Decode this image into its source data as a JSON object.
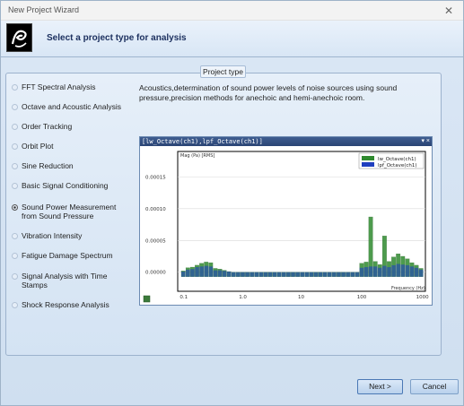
{
  "window": {
    "title": "New Project Wizard",
    "close_glyph": "✕"
  },
  "header": {
    "title": "Select a project type for analysis",
    "logo_icon": "app-logo-icon"
  },
  "group_label": "Project type",
  "project_types": [
    {
      "label": "FFT Spectral Analysis",
      "selected": false
    },
    {
      "label": "Octave and Acoustic Analysis",
      "selected": false
    },
    {
      "label": "Order Tracking",
      "selected": false
    },
    {
      "label": "Orbit Plot",
      "selected": false
    },
    {
      "label": "Sine Reduction",
      "selected": false
    },
    {
      "label": "Basic Signal Conditioning",
      "selected": false
    },
    {
      "label": "Sound Power Measurement\nfrom Sound Pressure",
      "selected": true
    },
    {
      "label": "Vibration Intensity",
      "selected": false
    },
    {
      "label": "Fatigue Damage Spectrum",
      "selected": false
    },
    {
      "label": "Signal Analysis with Time\nStamps",
      "selected": false
    },
    {
      "label": "Shock Response Analysis",
      "selected": false
    }
  ],
  "description": "Acoustics,determination of sound power levels of noise sources using sound pressure,precision methods for anechoic and hemi-anechoic room.",
  "chart_title_bar": "[lw_Octave(ch1),lpf_Octave(ch1)]",
  "chart_controls": "▾ ×",
  "chart_data": {
    "type": "bar",
    "ylabel": "Mag (Pa) [RMS]",
    "xlabel": "Frequency (Hz)",
    "x_scale": "log",
    "xlim": [
      0.08,
      1250
    ],
    "ylim": [
      -3e-05,
      0.00019
    ],
    "y_ticks": [
      "0.00015",
      "0.00010",
      "0.00005",
      "0.00000"
    ],
    "y_tick_values": [
      0.00015,
      0.0001,
      5e-05,
      0
    ],
    "x_ticks": [
      "0.1",
      "1.0",
      "10",
      "100",
      "1000"
    ],
    "x_tick_values": [
      0.1,
      1,
      10,
      100,
      1000
    ],
    "grid": true,
    "legend_position": "top-right",
    "series": [
      {
        "name": "lw_Octave(ch1)",
        "color": "#2f8a2f",
        "values": [
          2e-06,
          7e-06,
          8e-06,
          1.1e-05,
          1.4e-05,
          1.6e-05,
          1.5e-05,
          6e-06,
          5e-06,
          3e-06,
          1e-06,
          0,
          0,
          0,
          0,
          0,
          0,
          0,
          0,
          0,
          0,
          0,
          0,
          0,
          0,
          0,
          0,
          0,
          0,
          0,
          0,
          0,
          0,
          0,
          0,
          0,
          0,
          0,
          0,
          1.4e-05,
          1.6e-05,
          8.7e-05,
          1.7e-05,
          1.2e-05,
          5.7e-05,
          1.7e-05,
          2.4e-05,
          2.9e-05,
          2.5e-05,
          2.1e-05,
          1.5e-05,
          1.1e-05,
          6e-06
        ]
      },
      {
        "name": "lpf_Octave(ch1)",
        "color": "#1f3fbf",
        "values": [
          1e-06,
          4e-06,
          5e-06,
          8e-06,
          9e-06,
          1e-05,
          9e-06,
          3e-06,
          3e-06,
          2e-06,
          1e-06,
          0,
          0,
          0,
          0,
          0,
          0,
          0,
          0,
          0,
          0,
          0,
          0,
          0,
          0,
          0,
          0,
          0,
          0,
          0,
          0,
          0,
          0,
          0,
          0,
          0,
          0,
          0,
          0,
          7e-06,
          8e-06,
          9e-06,
          9e-06,
          7e-06,
          1e-05,
          8e-06,
          1.1e-05,
          1.3e-05,
          1.2e-05,
          1.1e-05,
          9e-06,
          7e-06,
          4e-06
        ]
      }
    ],
    "x": [
      0.1,
      0.125,
      0.16,
      0.2,
      0.25,
      0.315,
      0.4,
      0.5,
      0.63,
      0.8,
      1.0,
      1.25,
      1.6,
      2.0,
      2.5,
      3.15,
      4.0,
      5.0,
      6.3,
      8.0,
      10,
      12.5,
      16,
      20,
      25,
      31.5,
      40,
      50,
      63,
      80,
      100,
      125,
      160,
      200,
      250,
      315,
      400,
      500,
      630,
      40.5,
      50.5,
      63.5,
      80.5,
      100.5,
      125.5,
      160.5,
      200.5,
      250.5,
      315.5,
      400.5,
      500.5,
      630.5,
      800
    ]
  },
  "buttons": {
    "next": "Next >",
    "cancel": "Cancel"
  },
  "colors": {
    "accent": "#1b2f5e",
    "chart_titlebar": "#2a4474",
    "lw": "#2f8a2f",
    "lpf": "#1f3fbf"
  }
}
